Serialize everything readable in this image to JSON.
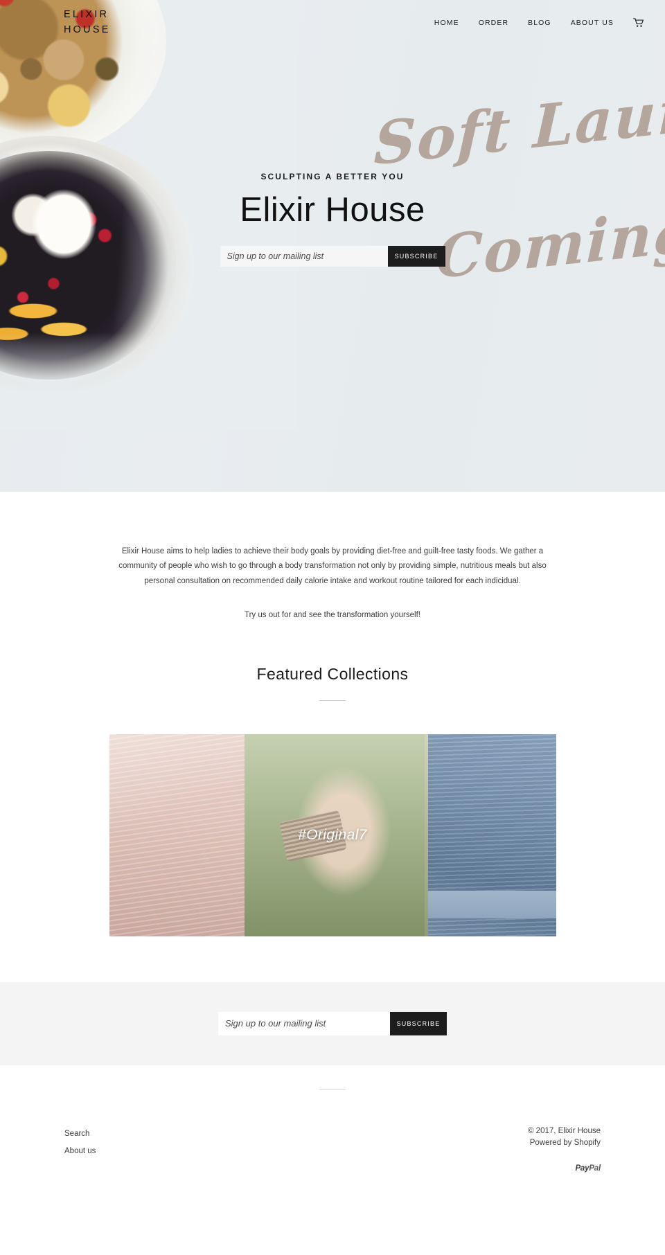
{
  "header": {
    "logo": "ELIXIR HOUSE",
    "logo_line1": "ELIXIR",
    "logo_line2": "HOUSE",
    "nav": [
      {
        "label": "HOME"
      },
      {
        "label": "ORDER"
      },
      {
        "label": "BLOG"
      },
      {
        "label": "ABOUT US"
      }
    ],
    "cart_icon": "shopping-cart-icon"
  },
  "hero": {
    "eyebrow": "SCULPTING A BETTER YOU",
    "title": "Elixir House",
    "script_line1": "Soft Launch",
    "script_line2": "Coming",
    "script_color": "#b0a196",
    "background_color": "#e8edf0",
    "newsletter": {
      "placeholder": "Sign up to our mailing list",
      "value": "",
      "button_label": "SUBSCRIBE",
      "button_color": "#1d1d1d"
    }
  },
  "about": {
    "paragraph_1": "Elixir House aims to help ladies to achieve their body goals by providing diet-free and guilt-free tasty foods. We gather a community of people who wish to go through a body transformation not only by providing simple, nutritious meals but also personal consultation on recommended daily calorie intake and workout routine tailored for each indicidual.",
    "paragraph_2": "Try us out for and see the transformation yourself!"
  },
  "featured": {
    "title": "Featured Collections",
    "collections": [
      {
        "label": "#Original7"
      }
    ]
  },
  "footer_newsletter": {
    "placeholder": "Sign up to our mailing list",
    "value": "",
    "button_label": "SUBSCRIBE"
  },
  "footer": {
    "links": [
      {
        "label": "Search"
      },
      {
        "label": "About us"
      }
    ],
    "copyright": "© 2017, Elixir House",
    "powered_prefix": "Powered by ",
    "powered_link": "Shopify",
    "payment_icon": "paypal-logo",
    "payment_pay": "Pay",
    "payment_pal": "Pal"
  }
}
